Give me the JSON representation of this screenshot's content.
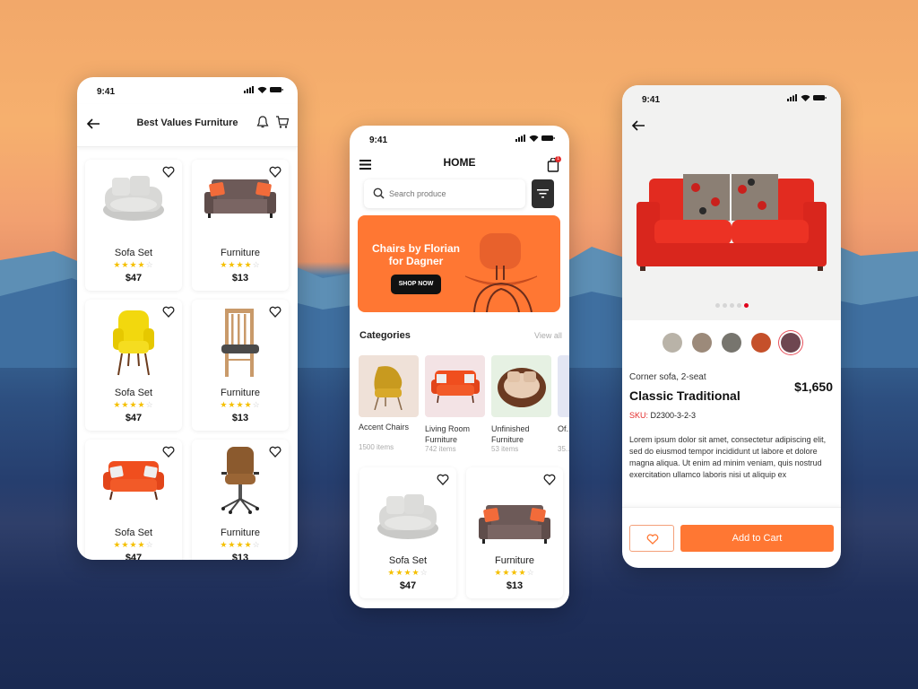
{
  "colors": {
    "accent": "#ff7733",
    "star": "#f5c000",
    "sku_red": "#e32b2b",
    "dot_active": "#e0001b",
    "dark_button": "#2e2e2e"
  },
  "status_bar": {
    "time": "9:41"
  },
  "screen_list": {
    "title": "Best Values Furniture",
    "back_icon": "arrow-left-icon",
    "header_icons": [
      "bell-icon",
      "cart-icon"
    ],
    "products": [
      {
        "name": "Sofa Set",
        "rating": 4,
        "max_rating": 5,
        "price": "$47",
        "image": "grey-round-armchair"
      },
      {
        "name": "Furniture",
        "rating": 4,
        "max_rating": 5,
        "price": "$13",
        "image": "brown-loveseat"
      },
      {
        "name": "Sofa Set",
        "rating": 4,
        "max_rating": 5,
        "price": "$47",
        "image": "yellow-wingback-chair"
      },
      {
        "name": "Furniture",
        "rating": 4,
        "max_rating": 5,
        "price": "$13",
        "image": "wooden-dining-chair"
      },
      {
        "name": "Sofa Set",
        "rating": 4,
        "max_rating": 5,
        "price": "$47",
        "image": "orange-loveseat"
      },
      {
        "name": "Furniture",
        "rating": 4,
        "max_rating": 5,
        "price": "$13",
        "image": "leather-office-chair"
      }
    ]
  },
  "screen_home": {
    "title": "HOME",
    "cart_badge": "1",
    "search": {
      "placeholder": "Search produce"
    },
    "banner": {
      "title_line1": "Chairs by Florian",
      "title_line2": "for Dagner",
      "cta": "SHOP NOW"
    },
    "categories_heading": "Categories",
    "view_all": "View all",
    "categories": [
      {
        "name": "Accent Chairs",
        "count": "1500 items"
      },
      {
        "name": "Living Room Furniture",
        "count": "742 items"
      },
      {
        "name": "Unfinished Furniture",
        "count": "53 items"
      },
      {
        "name": "Of...",
        "count": "35..."
      }
    ],
    "products": [
      {
        "name": "Sofa Set",
        "rating": 4,
        "max_rating": 5,
        "price": "$47"
      },
      {
        "name": "Furniture",
        "rating": 4,
        "max_rating": 5,
        "price": "$13"
      }
    ]
  },
  "screen_detail": {
    "subtitle": "Corner sofa, 2-seat",
    "title": "Classic Traditional",
    "price": "$1,650",
    "sku_label": "SKU:",
    "sku_value": "D2300-3-2-3",
    "description": "Lorem ipsum dolor sit amet, consectetur adipiscing elit, sed do eiusmod tempor incididunt ut labore et dolore magna aliqua. Ut enim ad minim veniam, quis nostrud exercitation ullamco laboris nisi ut aliquip ex",
    "carousel": {
      "count": 5,
      "active_index": 4
    },
    "swatches": [
      {
        "color": "#b9b3a8"
      },
      {
        "color": "#9c8a7a"
      },
      {
        "color": "#77756e"
      },
      {
        "color": "#c5502a"
      },
      {
        "color": "#6e4650",
        "selected": true
      }
    ],
    "add_to_cart": "Add to Cart"
  }
}
